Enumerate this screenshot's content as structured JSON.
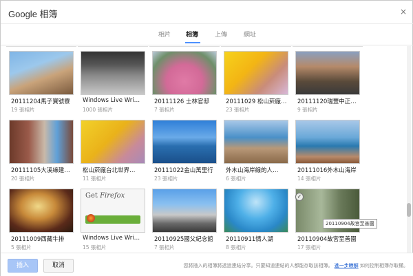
{
  "header": {
    "title": "Google 相簿",
    "close": "×"
  },
  "tabs": [
    {
      "label": "相片"
    },
    {
      "label": "相簿"
    },
    {
      "label": "上傳"
    },
    {
      "label": "網址"
    }
  ],
  "albums": [
    {
      "name": "20111204馬子寶號寮",
      "count": "19 張相片",
      "icon": "photo-thumbnail"
    },
    {
      "name": "Windows Live Wri…",
      "count": "1000 張相片",
      "icon": "photo-thumbnail"
    },
    {
      "name": "20111126 士林官邸",
      "count": "7 張相片",
      "icon": "photo-thumbnail"
    },
    {
      "name": "20111029 松山菸廠…",
      "count": "23 張相片",
      "icon": "photo-thumbnail"
    },
    {
      "name": "20111120瑞豐中正…",
      "count": "9 張相片",
      "icon": "photo-thumbnail"
    },
    {
      "name": "20111105大溪綠建…",
      "count": "20 張相片",
      "icon": "photo-thumbnail"
    },
    {
      "name": "松山菸廠台北世界…",
      "count": "11 張相片",
      "icon": "photo-thumbnail"
    },
    {
      "name": "20111022金山萬里行",
      "count": "23 張相片",
      "icon": "photo-thumbnail"
    },
    {
      "name": "外木山海岸線的人…",
      "count": "6 張相片",
      "icon": "photo-thumbnail"
    },
    {
      "name": "20111016外木山海岸",
      "count": "14 張相片",
      "icon": "photo-thumbnail"
    },
    {
      "name": "20111009西藏牛排",
      "count": "5 張相片",
      "icon": "photo-thumbnail"
    },
    {
      "name": "Windows Live Wri…",
      "count": "15 張相片",
      "icon": "photo-thumbnail"
    },
    {
      "name": "20110925國父紀念館",
      "count": "7 張相片",
      "icon": "photo-thumbnail"
    },
    {
      "name": "20110911情人湖",
      "count": "8 張相片",
      "icon": "photo-thumbnail"
    },
    {
      "name": "20110904故宮至善園",
      "count": "17 張相片",
      "icon": "photo-thumbnail"
    }
  ],
  "tooltip": "20110904故宮至善園",
  "footer": {
    "insert": "插入",
    "cancel": "取消",
    "info": "您將插入的相簿將透過連結分享。只要知道連結的人都能存取該相簿。",
    "link": "進一步瞭解",
    "info_tail": "如何控制相簿存取權。"
  },
  "colors": {
    "accent": "#4d90fe",
    "insert_disabled": "#a8c6f7",
    "link": "#1155cc"
  }
}
